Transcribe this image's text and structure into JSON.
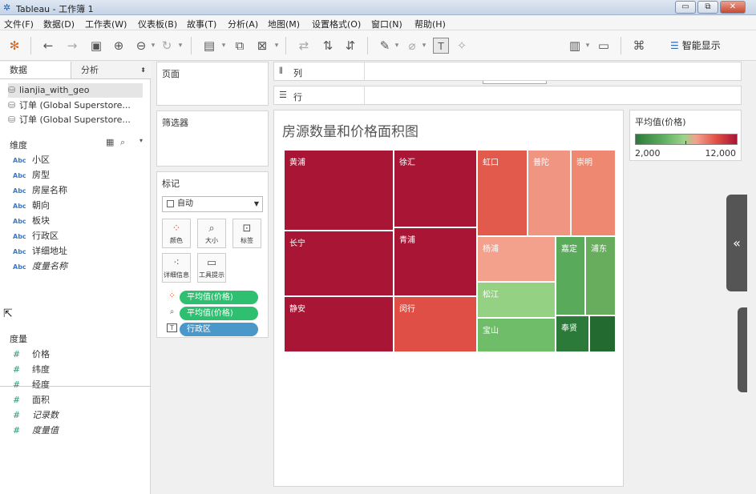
{
  "window": {
    "title": "Tableau - 工作簿 1",
    "min": "▭",
    "max": "⧉",
    "close": "✕"
  },
  "menu": [
    "文件(F)",
    "数据(D)",
    "工作表(W)",
    "仪表板(B)",
    "故事(T)",
    "分析(A)",
    "地图(M)",
    "设置格式(O)",
    "窗口(N)",
    "帮助(H)"
  ],
  "toolbar": {
    "fit_select": "标准",
    "show_me": "智能显示"
  },
  "left_pane": {
    "tabs": [
      "数据",
      "分析"
    ],
    "datasources": [
      "lianjia_with_geo",
      "订单 (Global Superstore...",
      "订单 (Global Superstore..."
    ],
    "dimensions_label": "维度",
    "dimensions": [
      "小区",
      "房型",
      "房屋名称",
      "朝向",
      "板块",
      "行政区",
      "详细地址",
      "度量名称"
    ],
    "dim_type": "Abc",
    "measures_label": "度量",
    "measures": [
      "价格",
      "纬度",
      "经度",
      "面积",
      "记录数",
      "度量值"
    ],
    "measure_type": "#"
  },
  "cards": {
    "pages": "页面",
    "filters": "筛选器",
    "marks": "标记",
    "mark_type": "自动",
    "mark_buttons": [
      "颜色",
      "大小",
      "标签",
      "详细信息",
      "工具提示"
    ],
    "pills": [
      "平均值(价格)",
      "平均值(价格)",
      "行政区"
    ]
  },
  "shelves": {
    "columns": "列",
    "rows": "行"
  },
  "view": {
    "title": "房源数量和价格面积图"
  },
  "colors": {
    "red_dark": "#a81535",
    "red": "#e04f45",
    "red_light": "#f19583",
    "green_light": "#94d182",
    "green": "#5aaa5c",
    "green_dark": "#2c7a3a",
    "accent_green": "#2fbf71",
    "accent_blue": "#4a97c9"
  },
  "chart_data": {
    "type": "treemap",
    "title": "房源数量和价格面积图",
    "color_field": "平均值(价格)",
    "color_range": [
      2000,
      12000
    ],
    "tiles": [
      {
        "label": "黄浦",
        "rank": 1,
        "color": "#a81535"
      },
      {
        "label": "长宁",
        "rank": 2,
        "color": "#a81535"
      },
      {
        "label": "静安",
        "rank": 3,
        "color": "#a81535"
      },
      {
        "label": "徐汇",
        "rank": 4,
        "color": "#a81535"
      },
      {
        "label": "青浦",
        "rank": 5,
        "color": "#a81535"
      },
      {
        "label": "闵行",
        "rank": 6,
        "color": "#e04f45"
      },
      {
        "label": "虹口",
        "rank": 7,
        "color": "#e25a4c"
      },
      {
        "label": "普陀",
        "rank": 8,
        "color": "#f19583"
      },
      {
        "label": "崇明",
        "rank": 9,
        "color": "#ef8870"
      },
      {
        "label": "杨浦",
        "rank": 10,
        "color": "#f3a08d"
      },
      {
        "label": "松江",
        "rank": 11,
        "color": "#94d182"
      },
      {
        "label": "宝山",
        "rank": 12,
        "color": "#6fbd68"
      },
      {
        "label": "嘉定",
        "rank": 13,
        "color": "#5aaa5c"
      },
      {
        "label": "浦东",
        "rank": 14,
        "color": "#68ad5d"
      },
      {
        "label": "奉贤",
        "rank": 15,
        "color": "#2c7a3a"
      },
      {
        "label": "",
        "rank": 16,
        "color": "#226a30"
      }
    ]
  },
  "legend": {
    "title": "平均值(价格)",
    "min": "2,000",
    "max": "12,000"
  }
}
